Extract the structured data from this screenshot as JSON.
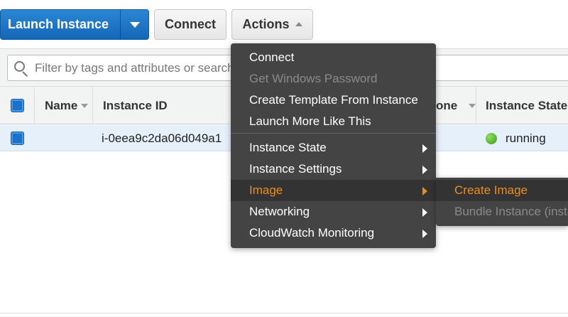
{
  "toolbar": {
    "launch_label": "Launch Instance",
    "connect_label": "Connect",
    "actions_label": "Actions"
  },
  "filter": {
    "placeholder": "Filter by tags and attributes or search by keyword"
  },
  "table": {
    "headers": [
      "Name",
      "Instance ID",
      "one",
      "Instance State"
    ],
    "rows": [
      {
        "name": "",
        "instance_id": "i-0eea9c2da06d049a1",
        "state": "running"
      }
    ]
  },
  "menu": {
    "items": [
      {
        "label": "Connect",
        "disabled": false
      },
      {
        "label": "Get Windows Password",
        "disabled": true
      },
      {
        "label": "Create Template From Instance",
        "disabled": false
      },
      {
        "label": "Launch More Like This",
        "disabled": false
      },
      {
        "label": "Instance State",
        "submenu": true
      },
      {
        "label": "Instance Settings",
        "submenu": true
      },
      {
        "label": "Image",
        "submenu": true,
        "active": true
      },
      {
        "label": "Networking",
        "submenu": true
      },
      {
        "label": "CloudWatch Monitoring",
        "submenu": true
      }
    ]
  },
  "submenu": {
    "items": [
      {
        "label": "Create Image",
        "active": true
      },
      {
        "label": "Bundle Instance (instance store AMI)",
        "disabled": true
      }
    ]
  },
  "colors": {
    "primary_button": "#1566b7",
    "menu_bg": "#444444",
    "active_text": "#ec8c1e",
    "status_running": "#3d9b1c"
  },
  "icons": [
    "chevron-down-icon",
    "chevron-up-icon",
    "search-icon",
    "sort-caret-icon",
    "checkbox-icon",
    "status-dot-icon",
    "submenu-arrow-icon"
  ]
}
